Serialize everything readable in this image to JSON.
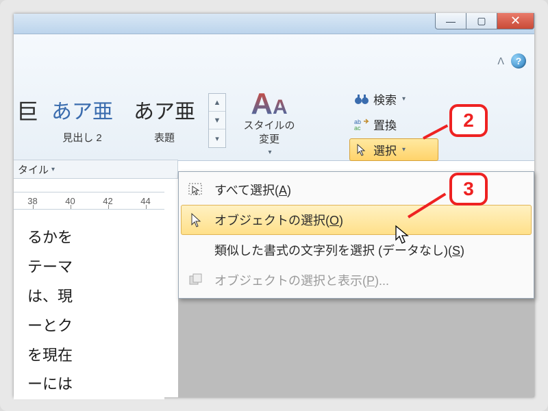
{
  "titlebar": {
    "minimize": "—",
    "maximize": "▢",
    "close": "✕"
  },
  "ribbon": {
    "help_caret": "ᐱ",
    "help_q": "?",
    "style_sample_1": "あア亜",
    "style_label_1": "見出し 2",
    "style_sample_2": "あア亜",
    "style_label_2": "表題",
    "gallery_up": "▲",
    "gallery_down": "▼",
    "gallery_more": "▾",
    "change_styles_icon": "A",
    "change_styles_label": "スタイルの\n変更",
    "change_styles_caret": "▾",
    "find_label": "検索",
    "replace_label": "置換",
    "select_label": "選択"
  },
  "group_label": "タイル",
  "group_label_caret": "▾",
  "ruler": {
    "t38": "38",
    "t40": "40",
    "t42": "42",
    "t44": "44"
  },
  "doc_lines": {
    "l1": "るかを",
    "l2": "テーマ",
    "l3": "は、現",
    "l4": "ーとク",
    "l5": "を現在",
    "l6": "ーには"
  },
  "dropdown": {
    "select_all": "すべて選択(",
    "select_all_key": "A",
    "select_all_end": ")",
    "select_objects": "オブジェクトの選択(",
    "select_objects_key": "O",
    "select_objects_end": ")",
    "select_similar": "類似した書式の文字列を選択 (データなし)(",
    "select_similar_key": "S",
    "select_similar_end": ")",
    "selection_pane": "オブジェクトの選択と表示(",
    "selection_pane_key": "P",
    "selection_pane_end": ")..."
  },
  "annotations": {
    "a2": "2",
    "a3": "3"
  }
}
